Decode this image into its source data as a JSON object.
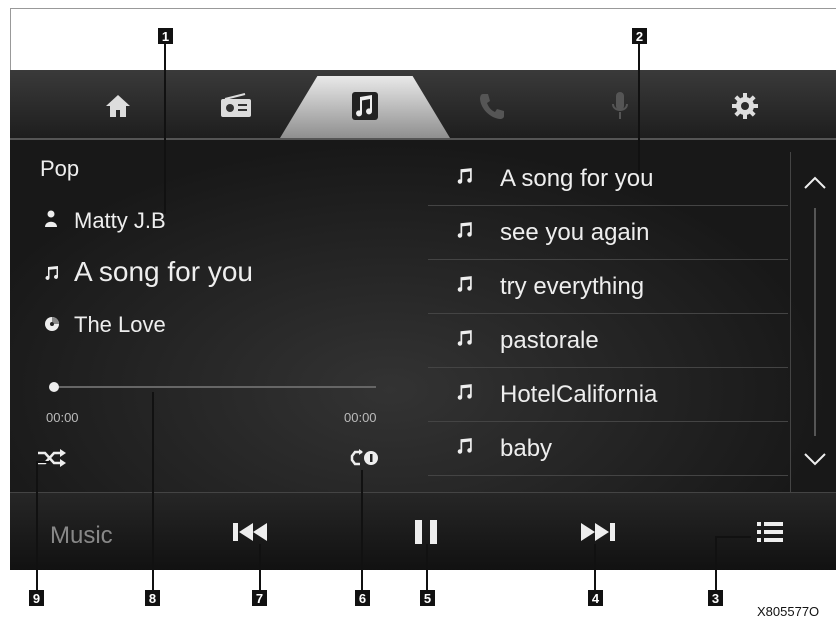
{
  "nav": {
    "tabs": [
      {
        "name": "home",
        "icon": "home-icon"
      },
      {
        "name": "radio",
        "icon": "radio-icon"
      },
      {
        "name": "music",
        "icon": "music-icon",
        "active": true
      },
      {
        "name": "phone",
        "icon": "phone-icon"
      },
      {
        "name": "voice",
        "icon": "microphone-icon"
      },
      {
        "name": "settings",
        "icon": "gear-icon"
      }
    ]
  },
  "now_playing": {
    "genre": "Pop",
    "artist": "Matty J.B",
    "title": "A song for you",
    "album": "The Love",
    "elapsed": "00:00",
    "total": "00:00",
    "progress": 0
  },
  "playlist": {
    "items": [
      "A song for you",
      "see you again",
      "try everything",
      "pastorale",
      "HotelCalifornia",
      "baby"
    ]
  },
  "bottom": {
    "source_label": "Music"
  },
  "callouts": [
    "1",
    "2",
    "3",
    "4",
    "5",
    "6",
    "7",
    "8",
    "9"
  ],
  "figure_code": "X805577O",
  "colors": {
    "background": "#1a1a1a",
    "text": "#eeeeee",
    "muted": "#888888"
  }
}
